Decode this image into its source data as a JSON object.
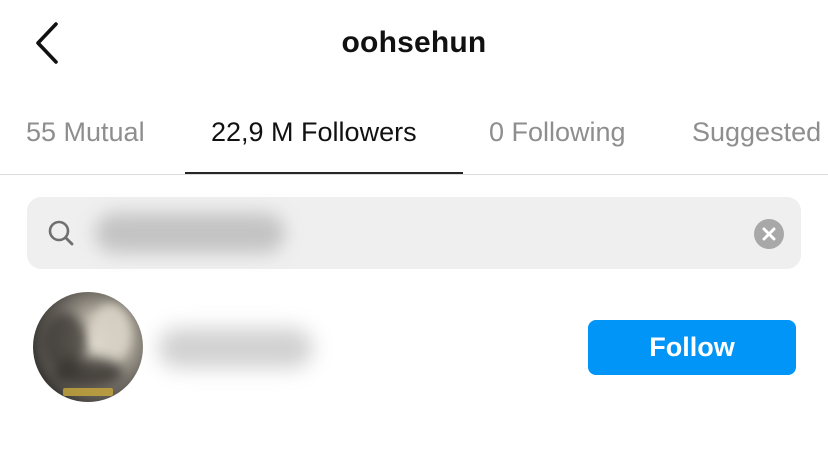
{
  "header": {
    "back_icon": "chevron-left-icon",
    "title": "oohsehun"
  },
  "tabs": [
    {
      "label": "55 Mutual",
      "active": false
    },
    {
      "label": "22,9 M Followers",
      "active": true
    },
    {
      "label": "0 Following",
      "active": false
    },
    {
      "label": "Suggested",
      "active": false
    }
  ],
  "search": {
    "icon": "search-icon",
    "clear_icon": "clear-icon"
  },
  "results": [
    {
      "follow_label": "Follow"
    }
  ],
  "colors": {
    "accent": "#0095f6",
    "tab_inactive": "#8e8e8e",
    "search_bg": "#efefef"
  }
}
